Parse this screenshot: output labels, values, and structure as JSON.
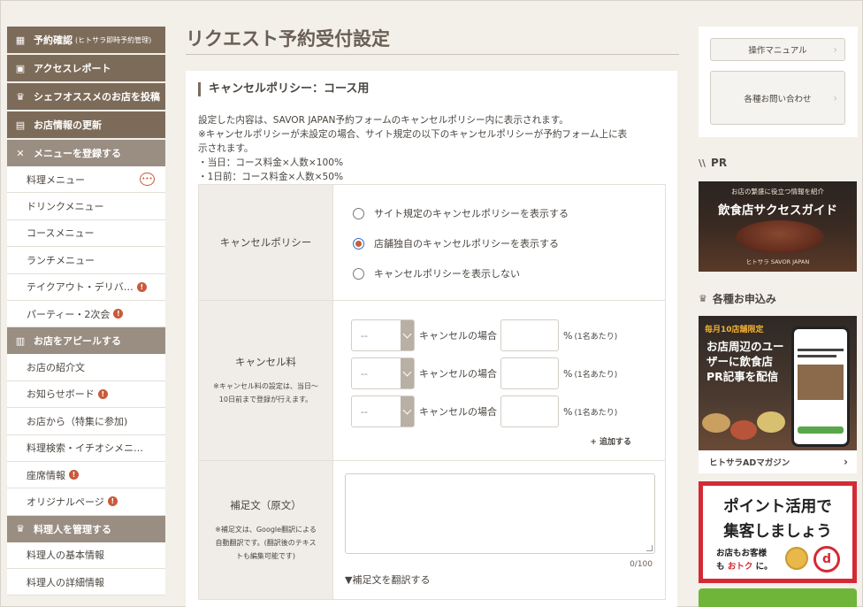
{
  "page": {
    "title": "リクエスト予約受付設定"
  },
  "sidebar": {
    "headers": {
      "reservation": {
        "label": "予約確認",
        "sub": "(ヒトサラ即時予約管理)"
      },
      "access": {
        "label": "アクセスレポート"
      },
      "chef_post": {
        "label": "シェフオススメのお店を投稿"
      },
      "shop_update": {
        "label": "お店情報の更新"
      },
      "menu": {
        "label": "メニューを登録する"
      },
      "appeal": {
        "label": "お店をアピールする"
      },
      "chef_manage": {
        "label": "料理人を管理する"
      }
    },
    "menu_items": [
      {
        "label": "料理メニュー",
        "badge": ""
      },
      {
        "label": "ドリンクメニュー",
        "badge": ""
      },
      {
        "label": "コースメニュー",
        "badge": ""
      },
      {
        "label": "ランチメニュー",
        "badge": ""
      },
      {
        "label": "テイクアウト・デリバ…",
        "badge": "!"
      },
      {
        "label": "パーティー・2次会",
        "badge": "!"
      }
    ],
    "appeal_items": [
      {
        "label": "お店の紹介文",
        "badge": ""
      },
      {
        "label": "お知らせボード",
        "badge": "!"
      },
      {
        "label": "お店から（特集に参加)",
        "badge": ""
      },
      {
        "label": "料理検索・イチオシメニ…",
        "badge": ""
      },
      {
        "label": "座席情報",
        "badge": "!"
      },
      {
        "label": "オリジナルページ",
        "badge": "!"
      }
    ],
    "chef_items": [
      {
        "label": "料理人の基本情報"
      },
      {
        "label": "料理人の詳細情報"
      }
    ]
  },
  "section": {
    "title": "キャンセルポリシー：コース用",
    "desc_lines": [
      "設定した内容は、SAVOR JAPAN予約フォームのキャンセルポリシー内に表示されます。",
      "※キャンセルポリシーが未設定の場合、サイト規定の以下のキャンセルポリシーが予約フォーム上に表",
      "示されます。",
      "・当日：コース料金×人数×100%",
      "・1日前：コース料金×人数×50%"
    ]
  },
  "form": {
    "policy": {
      "label": "キャンセルポリシー",
      "options": [
        {
          "label": "サイト規定のキャンセルポリシーを表示する",
          "checked": false
        },
        {
          "label": "店舗独自のキャンセルポリシーを表示する",
          "checked": true
        },
        {
          "label": "キャンセルポリシーを表示しない",
          "checked": false
        }
      ]
    },
    "fee": {
      "label": "キャンセル料",
      "note_line1": "※キャンセル料の設定は、当日〜",
      "note_line2": "10日前まで登録が行えます。",
      "rows": [
        {
          "select": "--",
          "case": "キャンセルの場合",
          "pct": "%",
          "per": "(1名あたり)"
        },
        {
          "select": "--",
          "case": "キャンセルの場合",
          "pct": "%",
          "per": "(1名あたり)"
        },
        {
          "select": "--",
          "case": "キャンセルの場合",
          "pct": "%",
          "per": "(1名あたり)"
        }
      ],
      "add_label": "+ 追加する"
    },
    "supplement": {
      "label": "補足文（原文）",
      "note_line1": "※補足文は、Google翻訳による",
      "note_line2": "自動翻訳です。(翻訳後のテキス",
      "note_line3": "トも編集可能です)",
      "counter": "0/100",
      "translate_label": "▼補足文を翻訳する"
    }
  },
  "right": {
    "manual_label": "操作マニュアル",
    "inquiry_label": "各種お問い合わせ",
    "pr_heading": "PR",
    "pr_banner": {
      "sub": "お店の繁盛に役立つ情報を紹介",
      "main": "飲食店サクセスガイド",
      "logos": "ヒトサラ  SAVOR JAPAN"
    },
    "apply_heading": "各種お申込み",
    "ad_banner": {
      "tag": "毎月10店舗限定",
      "text": "お店周辺のユーザーに飲食店PR記事を配信"
    },
    "ad_caption": "ヒトサラADマガジン",
    "point_banner": {
      "line1": "ポイント活用で",
      "line2": "集客しましょう",
      "sub1": "お店もお客様",
      "sub2a": "も ",
      "sub2b": "おトク",
      "sub2c": " に。",
      "d_mark": "d"
    }
  },
  "colors": {
    "sidebar_header": "#8c7a68",
    "accent_red": "#c95a3a",
    "banner_red": "#d42a35",
    "page_bg": "#f3efe9"
  }
}
